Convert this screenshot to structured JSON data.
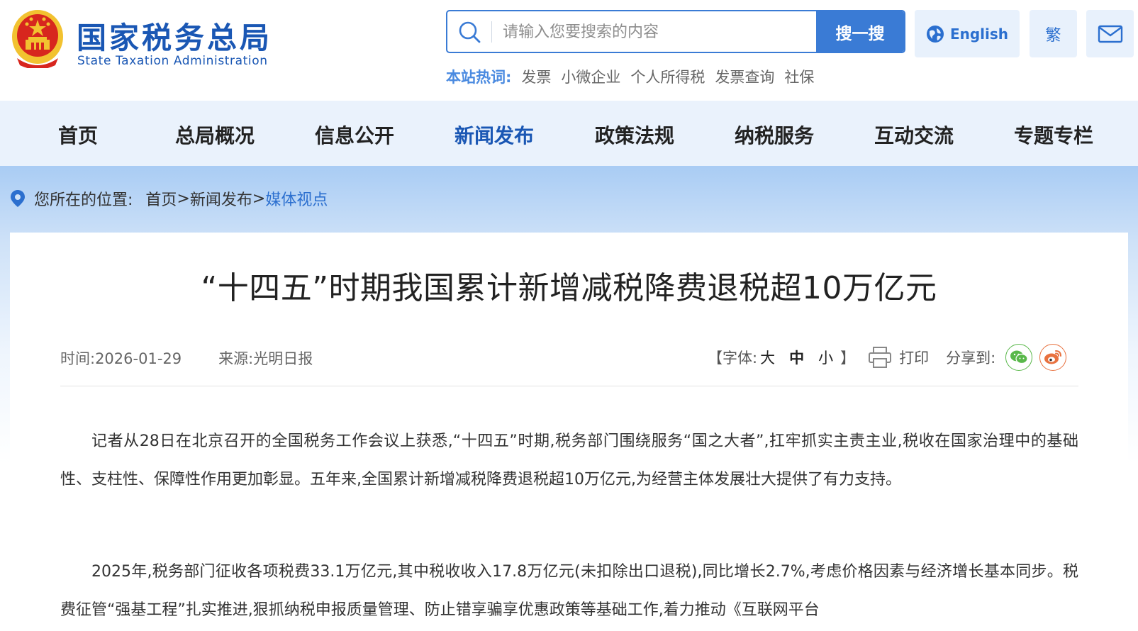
{
  "header": {
    "site_name_cn": "国家税务总局",
    "site_name_en": "State Taxation Administration",
    "search": {
      "placeholder": "请输入您要搜索的内容",
      "button_label": "搜一搜"
    },
    "english_label": "English",
    "traditional_label": "繁",
    "hot": {
      "label": "本站热词:",
      "items": [
        "发票",
        "小微企业",
        "个人所得税",
        "发票查询",
        "社保"
      ]
    }
  },
  "nav": {
    "items": [
      "首页",
      "总局概况",
      "信息公开",
      "新闻发布",
      "政策法规",
      "纳税服务",
      "互动交流",
      "专题专栏"
    ],
    "active": "新闻发布"
  },
  "breadcrumb": {
    "label": "您所在的位置:",
    "home": "首页",
    "sep1": ">",
    "section": "新闻发布",
    "sep2": ">",
    "current": "媒体视点"
  },
  "article": {
    "title": "“十四五”时期我国累计新增减税降费退税超10万亿元",
    "time": "时间:2026-01-29",
    "source": "来源:光明日报",
    "font_size": {
      "label": "【字体:",
      "large": "大",
      "medium": "中",
      "small": "小",
      "close": "】"
    },
    "print_label": "打印",
    "share_label": "分享到:",
    "paragraphs": [
      "记者从28日在北京召开的全国税务工作会议上获悉,“十四五”时期,税务部门围绕服务“国之大者”,扛牢抓实主责主业,税收在国家治理中的基础性、支柱性、保障性作用更加彰显。五年来,全国累计新增减税降费退税超10万亿元,为经营主体发展壮大提供了有力支持。",
      "2025年,税务部门征收各项税费33.1万亿元,其中税收收入17.8万亿元(未扣除出口退税),同比增长2.7%,考虑价格因素与经济增长基本同步。税费征管“强基工程”扎实推进,狠抓纳税申报质量管理、防止错享骗享优惠政策等基础工作,着力推动《互联网平台"
    ]
  },
  "colors": {
    "brand_blue": "#1a57b4",
    "accent_blue": "#3a7bd5",
    "nav_bg": "#eaf2fc",
    "emblem_red": "#d7261e",
    "emblem_gold": "#f2c230"
  }
}
